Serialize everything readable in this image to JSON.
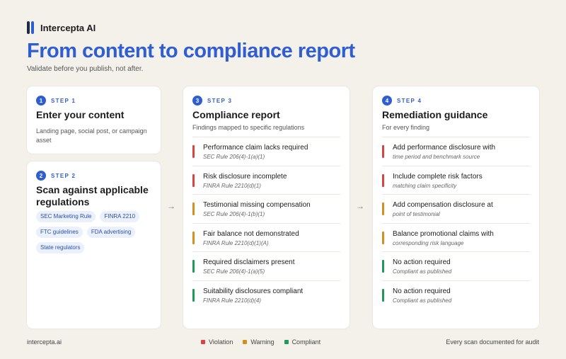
{
  "brand": {
    "name": "Intercepta AI"
  },
  "header": {
    "title": "From content to compliance report",
    "subtitle": "Validate before you publish, not after."
  },
  "colors": {
    "accent": "#2f5ed2",
    "violation": "#d64541",
    "warning": "#d4901f",
    "compliant": "#1f9a5b"
  },
  "steps": [
    {
      "number": "1",
      "label": "STEP 1",
      "title": "Enter your content",
      "subtitle": "Landing page, social post, or campaign asset"
    },
    {
      "number": "2",
      "label": "STEP 2",
      "title": "Scan against applicable regulations",
      "tags": [
        "SEC Marketing Rule",
        "FINRA 2210",
        "FTC guidelines",
        "FDA advertising",
        "State regulators"
      ]
    },
    {
      "number": "3",
      "label": "STEP 3",
      "title": "Compliance report",
      "subtitle": "Findings mapped to specific regulations",
      "rows": [
        {
          "status": "violation",
          "title": "Performance claim lacks required",
          "detail": "SEC Rule 206(4)-1(a)(1)"
        },
        {
          "status": "violation",
          "title": "Risk disclosure incomplete",
          "detail": "FINRA Rule 2210(d)(1)"
        },
        {
          "status": "warning",
          "title": "Testimonial missing compensation",
          "detail": "SEC Rule 206(4)-1(b)(1)"
        },
        {
          "status": "warning",
          "title": "Fair balance not demonstrated",
          "detail": "FINRA Rule 2210(d)(1)(A)"
        },
        {
          "status": "compliant",
          "title": "Required disclaimers present",
          "detail": "SEC Rule 206(4)-1(a)(5)"
        },
        {
          "status": "compliant",
          "title": "Suitability disclosures compliant",
          "detail": "FINRA Rule 2210(d)(4)"
        }
      ]
    },
    {
      "number": "4",
      "label": "STEP 4",
      "title": "Remediation guidance",
      "subtitle": "For every finding",
      "rows": [
        {
          "status": "violation",
          "title": "Add performance disclosure with",
          "detail": "time period and benchmark source"
        },
        {
          "status": "violation",
          "title": "Include complete risk factors",
          "detail": "matching claim specificity"
        },
        {
          "status": "warning",
          "title": "Add compensation disclosure at",
          "detail": "point of testimonial"
        },
        {
          "status": "warning",
          "title": "Balance promotional claims with",
          "detail": "corresponding risk language"
        },
        {
          "status": "compliant",
          "title": "No action required",
          "detail": "Compliant as published"
        },
        {
          "status": "compliant",
          "title": "No action required",
          "detail": "Compliant as published"
        }
      ]
    }
  ],
  "arrows": [
    "→",
    "→"
  ],
  "legend": [
    {
      "status": "violation",
      "label": "Violation"
    },
    {
      "status": "warning",
      "label": "Warning"
    },
    {
      "status": "compliant",
      "label": "Compliant"
    }
  ],
  "footer": {
    "left": "intercepta.ai",
    "right": "Every scan documented for audit"
  }
}
